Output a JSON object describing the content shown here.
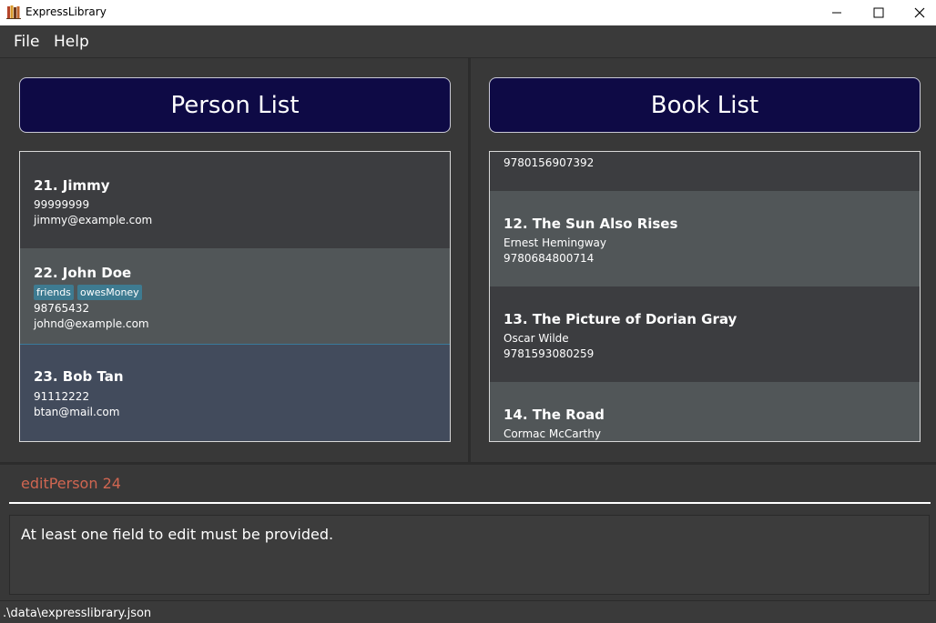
{
  "window": {
    "title": "ExpressLibrary"
  },
  "menu": {
    "file": "File",
    "help": "Help"
  },
  "person_panel": {
    "header": "Person List",
    "items": [
      {
        "title": "21.  Jimmy",
        "phone": "99999999",
        "email": "jimmy@example.com",
        "tags": []
      },
      {
        "title": "22.  John Doe",
        "phone": "98765432",
        "email": "johnd@example.com",
        "tags": [
          "friends",
          "owesMoney"
        ]
      },
      {
        "title": "23.  Bob Tan",
        "phone": "91112222",
        "email": "btan@mail.com",
        "tags": []
      }
    ]
  },
  "book_panel": {
    "header": "Book List",
    "items": [
      {
        "title": "",
        "line1": "9780156907392"
      },
      {
        "title": "12.  The Sun Also Rises",
        "line1": "Ernest Hemingway",
        "line2": "9780684800714"
      },
      {
        "title": "13.  The Picture of Dorian Gray",
        "line1": "Oscar Wilde",
        "line2": "9781593080259"
      },
      {
        "title": "14.  The Road",
        "line1": "Cormac McCarthy"
      }
    ]
  },
  "command": {
    "value": "editPerson 24"
  },
  "result": {
    "text": "At least one field to edit must be provided."
  },
  "status": {
    "path": ".\\data\\expresslibrary.json"
  },
  "colors": {
    "header_bg": "#0e0a45",
    "tag_bg": "#3e7b91",
    "command_text": "#d06651",
    "selected_card": "#424b5c"
  }
}
